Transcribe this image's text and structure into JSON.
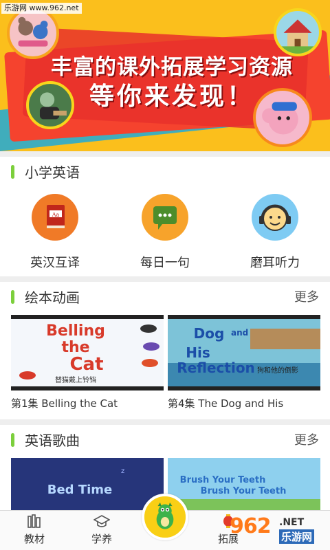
{
  "watermark_top": "乐游网 www.962.net",
  "banner": {
    "headline": "丰富的课外拓展学习资源",
    "sub": "等你来发现！"
  },
  "section_english": {
    "title": "小学英语",
    "tools": [
      {
        "label": "英汉互译",
        "icon": "dictionary-icon",
        "color": "#f07a27"
      },
      {
        "label": "每日一句",
        "icon": "chat-bubble-icon",
        "color": "#f7a32b"
      },
      {
        "label": "磨耳听力",
        "icon": "headphones-face-icon",
        "color": "#7ecbf3"
      }
    ]
  },
  "section_picturebook": {
    "title": "绘本动画",
    "more": "更多",
    "items": [
      {
        "caption": "第1集  Belling the Cat",
        "thumb_title": "Belling the Cat",
        "thumb_cn": "替猫戴上铃铛"
      },
      {
        "caption": "第4集  The Dog and His",
        "thumb_title": "The Dog and His Reflection",
        "thumb_cn": "狗和他的倒影"
      }
    ]
  },
  "section_songs": {
    "title": "英语歌曲",
    "more": "更多",
    "items": [
      {
        "thumb_title": "Bed Time"
      },
      {
        "thumb_title": "Brush Your Teeth"
      }
    ]
  },
  "bottom_nav": {
    "items": [
      {
        "label": "教材",
        "icon": "book-stack-icon"
      },
      {
        "label": "学养",
        "icon": "graduation-cap-icon"
      },
      {
        "label": "拓展",
        "icon": "lantern-icon"
      }
    ],
    "center_icon": "dragon-mascot-icon"
  },
  "watermark_bottom": {
    "brand": "962",
    "net": ".NET",
    "cn": "乐游网"
  },
  "colors": {
    "accent_green": "#7ccf3c",
    "banner_yellow": "#fbbf1c",
    "banner_red": "#e8302a"
  }
}
